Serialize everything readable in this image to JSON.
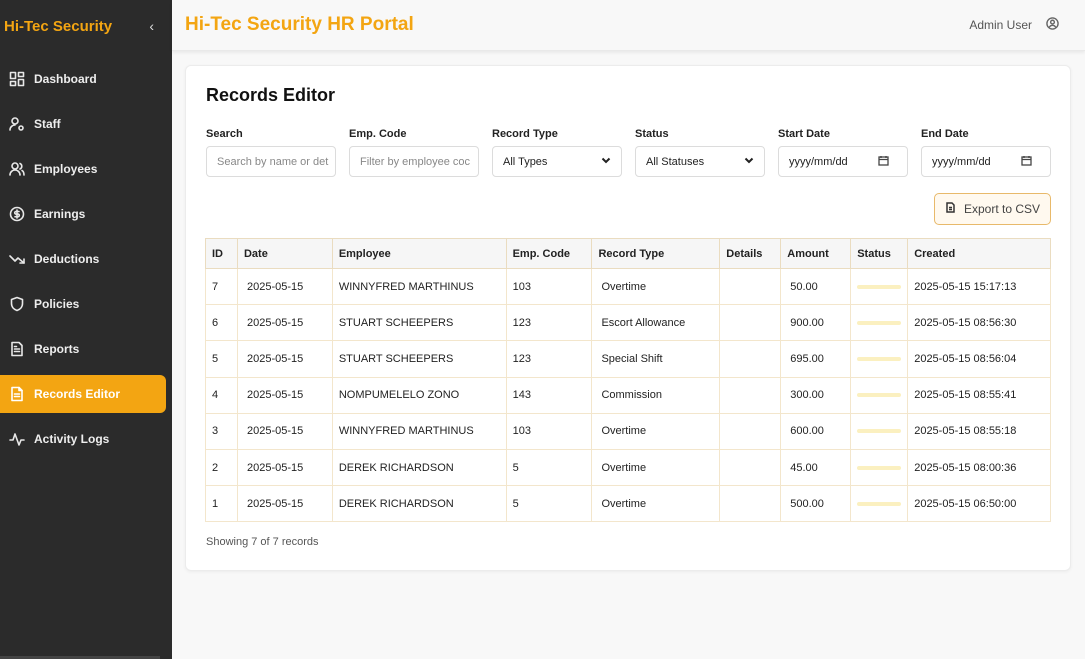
{
  "sidebar": {
    "brand": "Hi-Tec Security",
    "items": [
      {
        "label": "Dashboard",
        "icon": "grid-icon"
      },
      {
        "label": "Staff",
        "icon": "user-gear-icon"
      },
      {
        "label": "Employees",
        "icon": "users-icon"
      },
      {
        "label": "Earnings",
        "icon": "dollar-icon"
      },
      {
        "label": "Deductions",
        "icon": "trend-down-icon"
      },
      {
        "label": "Policies",
        "icon": "shield-icon"
      },
      {
        "label": "Reports",
        "icon": "report-icon"
      },
      {
        "label": "Records Editor",
        "icon": "document-icon",
        "active": true
      },
      {
        "label": "Activity Logs",
        "icon": "activity-icon"
      }
    ]
  },
  "header": {
    "title": "Hi-Tec Security HR Portal",
    "user": "Admin User"
  },
  "page": {
    "title": "Records Editor",
    "filters": {
      "search_label": "Search",
      "search_placeholder": "Search by name or det",
      "empcode_label": "Emp. Code",
      "empcode_placeholder": "Filter by employee coc",
      "type_label": "Record Type",
      "type_value": "All Types",
      "status_label": "Status",
      "status_value": "All Statuses",
      "start_label": "Start Date",
      "start_value": "yyyy/mm/dd",
      "end_label": "End Date",
      "end_value": "yyyy/mm/dd"
    },
    "export_label": "Export to CSV",
    "table": {
      "headers": [
        "ID",
        "Date",
        "Employee",
        "Emp. Code",
        "Record Type",
        "Details",
        "Amount",
        "Status",
        "Created"
      ],
      "rows": [
        {
          "id": "7",
          "date": "2025-05-15",
          "employee": "WINNYFRED MARTHINUS",
          "code": "103",
          "type": "Overtime",
          "details": "",
          "amount": "50.00",
          "created": "2025-05-15 15:17:13"
        },
        {
          "id": "6",
          "date": "2025-05-15",
          "employee": "STUART SCHEEPERS",
          "code": "123",
          "type": "Escort Allowance",
          "details": "",
          "amount": "900.00",
          "created": "2025-05-15 08:56:30"
        },
        {
          "id": "5",
          "date": "2025-05-15",
          "employee": "STUART SCHEEPERS",
          "code": "123",
          "type": "Special Shift",
          "details": "",
          "amount": "695.00",
          "created": "2025-05-15 08:56:04"
        },
        {
          "id": "4",
          "date": "2025-05-15",
          "employee": "NOMPUMELELO ZONO",
          "code": "143",
          "type": "Commission",
          "details": "",
          "amount": "300.00",
          "created": "2025-05-15 08:55:41"
        },
        {
          "id": "3",
          "date": "2025-05-15",
          "employee": "WINNYFRED MARTHINUS",
          "code": "103",
          "type": "Overtime",
          "details": "",
          "amount": "600.00",
          "created": "2025-05-15 08:55:18"
        },
        {
          "id": "2",
          "date": "2025-05-15",
          "employee": "DEREK RICHARDSON",
          "code": "5",
          "type": "Overtime",
          "details": "",
          "amount": "45.00",
          "created": "2025-05-15 08:00:36"
        },
        {
          "id": "1",
          "date": "2025-05-15",
          "employee": "DEREK RICHARDSON",
          "code": "5",
          "type": "Overtime",
          "details": "",
          "amount": "500.00",
          "created": "2025-05-15 06:50:00"
        }
      ]
    },
    "footer": "Showing 7 of 7 records"
  },
  "colors": {
    "accent": "#f3a512",
    "sidebar_bg": "#2b2b2b",
    "status_bar": "#fbf0c0"
  }
}
